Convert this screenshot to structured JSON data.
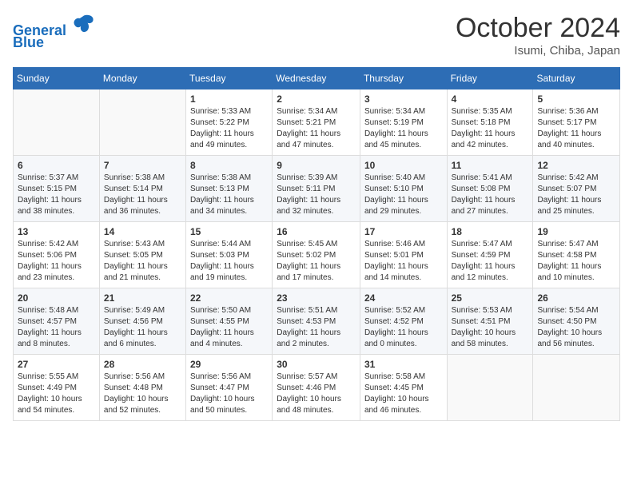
{
  "logo": {
    "line1": "General",
    "line2": "Blue"
  },
  "calendar": {
    "month": "October 2024",
    "location": "Isumi, Chiba, Japan"
  },
  "headers": [
    "Sunday",
    "Monday",
    "Tuesday",
    "Wednesday",
    "Thursday",
    "Friday",
    "Saturday"
  ],
  "weeks": [
    [
      {
        "day": "",
        "sunrise": "",
        "sunset": "",
        "daylight": ""
      },
      {
        "day": "",
        "sunrise": "",
        "sunset": "",
        "daylight": ""
      },
      {
        "day": "1",
        "sunrise": "Sunrise: 5:33 AM",
        "sunset": "Sunset: 5:22 PM",
        "daylight": "Daylight: 11 hours and 49 minutes."
      },
      {
        "day": "2",
        "sunrise": "Sunrise: 5:34 AM",
        "sunset": "Sunset: 5:21 PM",
        "daylight": "Daylight: 11 hours and 47 minutes."
      },
      {
        "day": "3",
        "sunrise": "Sunrise: 5:34 AM",
        "sunset": "Sunset: 5:19 PM",
        "daylight": "Daylight: 11 hours and 45 minutes."
      },
      {
        "day": "4",
        "sunrise": "Sunrise: 5:35 AM",
        "sunset": "Sunset: 5:18 PM",
        "daylight": "Daylight: 11 hours and 42 minutes."
      },
      {
        "day": "5",
        "sunrise": "Sunrise: 5:36 AM",
        "sunset": "Sunset: 5:17 PM",
        "daylight": "Daylight: 11 hours and 40 minutes."
      }
    ],
    [
      {
        "day": "6",
        "sunrise": "Sunrise: 5:37 AM",
        "sunset": "Sunset: 5:15 PM",
        "daylight": "Daylight: 11 hours and 38 minutes."
      },
      {
        "day": "7",
        "sunrise": "Sunrise: 5:38 AM",
        "sunset": "Sunset: 5:14 PM",
        "daylight": "Daylight: 11 hours and 36 minutes."
      },
      {
        "day": "8",
        "sunrise": "Sunrise: 5:38 AM",
        "sunset": "Sunset: 5:13 PM",
        "daylight": "Daylight: 11 hours and 34 minutes."
      },
      {
        "day": "9",
        "sunrise": "Sunrise: 5:39 AM",
        "sunset": "Sunset: 5:11 PM",
        "daylight": "Daylight: 11 hours and 32 minutes."
      },
      {
        "day": "10",
        "sunrise": "Sunrise: 5:40 AM",
        "sunset": "Sunset: 5:10 PM",
        "daylight": "Daylight: 11 hours and 29 minutes."
      },
      {
        "day": "11",
        "sunrise": "Sunrise: 5:41 AM",
        "sunset": "Sunset: 5:08 PM",
        "daylight": "Daylight: 11 hours and 27 minutes."
      },
      {
        "day": "12",
        "sunrise": "Sunrise: 5:42 AM",
        "sunset": "Sunset: 5:07 PM",
        "daylight": "Daylight: 11 hours and 25 minutes."
      }
    ],
    [
      {
        "day": "13",
        "sunrise": "Sunrise: 5:42 AM",
        "sunset": "Sunset: 5:06 PM",
        "daylight": "Daylight: 11 hours and 23 minutes."
      },
      {
        "day": "14",
        "sunrise": "Sunrise: 5:43 AM",
        "sunset": "Sunset: 5:05 PM",
        "daylight": "Daylight: 11 hours and 21 minutes."
      },
      {
        "day": "15",
        "sunrise": "Sunrise: 5:44 AM",
        "sunset": "Sunset: 5:03 PM",
        "daylight": "Daylight: 11 hours and 19 minutes."
      },
      {
        "day": "16",
        "sunrise": "Sunrise: 5:45 AM",
        "sunset": "Sunset: 5:02 PM",
        "daylight": "Daylight: 11 hours and 17 minutes."
      },
      {
        "day": "17",
        "sunrise": "Sunrise: 5:46 AM",
        "sunset": "Sunset: 5:01 PM",
        "daylight": "Daylight: 11 hours and 14 minutes."
      },
      {
        "day": "18",
        "sunrise": "Sunrise: 5:47 AM",
        "sunset": "Sunset: 4:59 PM",
        "daylight": "Daylight: 11 hours and 12 minutes."
      },
      {
        "day": "19",
        "sunrise": "Sunrise: 5:47 AM",
        "sunset": "Sunset: 4:58 PM",
        "daylight": "Daylight: 11 hours and 10 minutes."
      }
    ],
    [
      {
        "day": "20",
        "sunrise": "Sunrise: 5:48 AM",
        "sunset": "Sunset: 4:57 PM",
        "daylight": "Daylight: 11 hours and 8 minutes."
      },
      {
        "day": "21",
        "sunrise": "Sunrise: 5:49 AM",
        "sunset": "Sunset: 4:56 PM",
        "daylight": "Daylight: 11 hours and 6 minutes."
      },
      {
        "day": "22",
        "sunrise": "Sunrise: 5:50 AM",
        "sunset": "Sunset: 4:55 PM",
        "daylight": "Daylight: 11 hours and 4 minutes."
      },
      {
        "day": "23",
        "sunrise": "Sunrise: 5:51 AM",
        "sunset": "Sunset: 4:53 PM",
        "daylight": "Daylight: 11 hours and 2 minutes."
      },
      {
        "day": "24",
        "sunrise": "Sunrise: 5:52 AM",
        "sunset": "Sunset: 4:52 PM",
        "daylight": "Daylight: 11 hours and 0 minutes."
      },
      {
        "day": "25",
        "sunrise": "Sunrise: 5:53 AM",
        "sunset": "Sunset: 4:51 PM",
        "daylight": "Daylight: 10 hours and 58 minutes."
      },
      {
        "day": "26",
        "sunrise": "Sunrise: 5:54 AM",
        "sunset": "Sunset: 4:50 PM",
        "daylight": "Daylight: 10 hours and 56 minutes."
      }
    ],
    [
      {
        "day": "27",
        "sunrise": "Sunrise: 5:55 AM",
        "sunset": "Sunset: 4:49 PM",
        "daylight": "Daylight: 10 hours and 54 minutes."
      },
      {
        "day": "28",
        "sunrise": "Sunrise: 5:56 AM",
        "sunset": "Sunset: 4:48 PM",
        "daylight": "Daylight: 10 hours and 52 minutes."
      },
      {
        "day": "29",
        "sunrise": "Sunrise: 5:56 AM",
        "sunset": "Sunset: 4:47 PM",
        "daylight": "Daylight: 10 hours and 50 minutes."
      },
      {
        "day": "30",
        "sunrise": "Sunrise: 5:57 AM",
        "sunset": "Sunset: 4:46 PM",
        "daylight": "Daylight: 10 hours and 48 minutes."
      },
      {
        "day": "31",
        "sunrise": "Sunrise: 5:58 AM",
        "sunset": "Sunset: 4:45 PM",
        "daylight": "Daylight: 10 hours and 46 minutes."
      },
      {
        "day": "",
        "sunrise": "",
        "sunset": "",
        "daylight": ""
      },
      {
        "day": "",
        "sunrise": "",
        "sunset": "",
        "daylight": ""
      }
    ]
  ]
}
